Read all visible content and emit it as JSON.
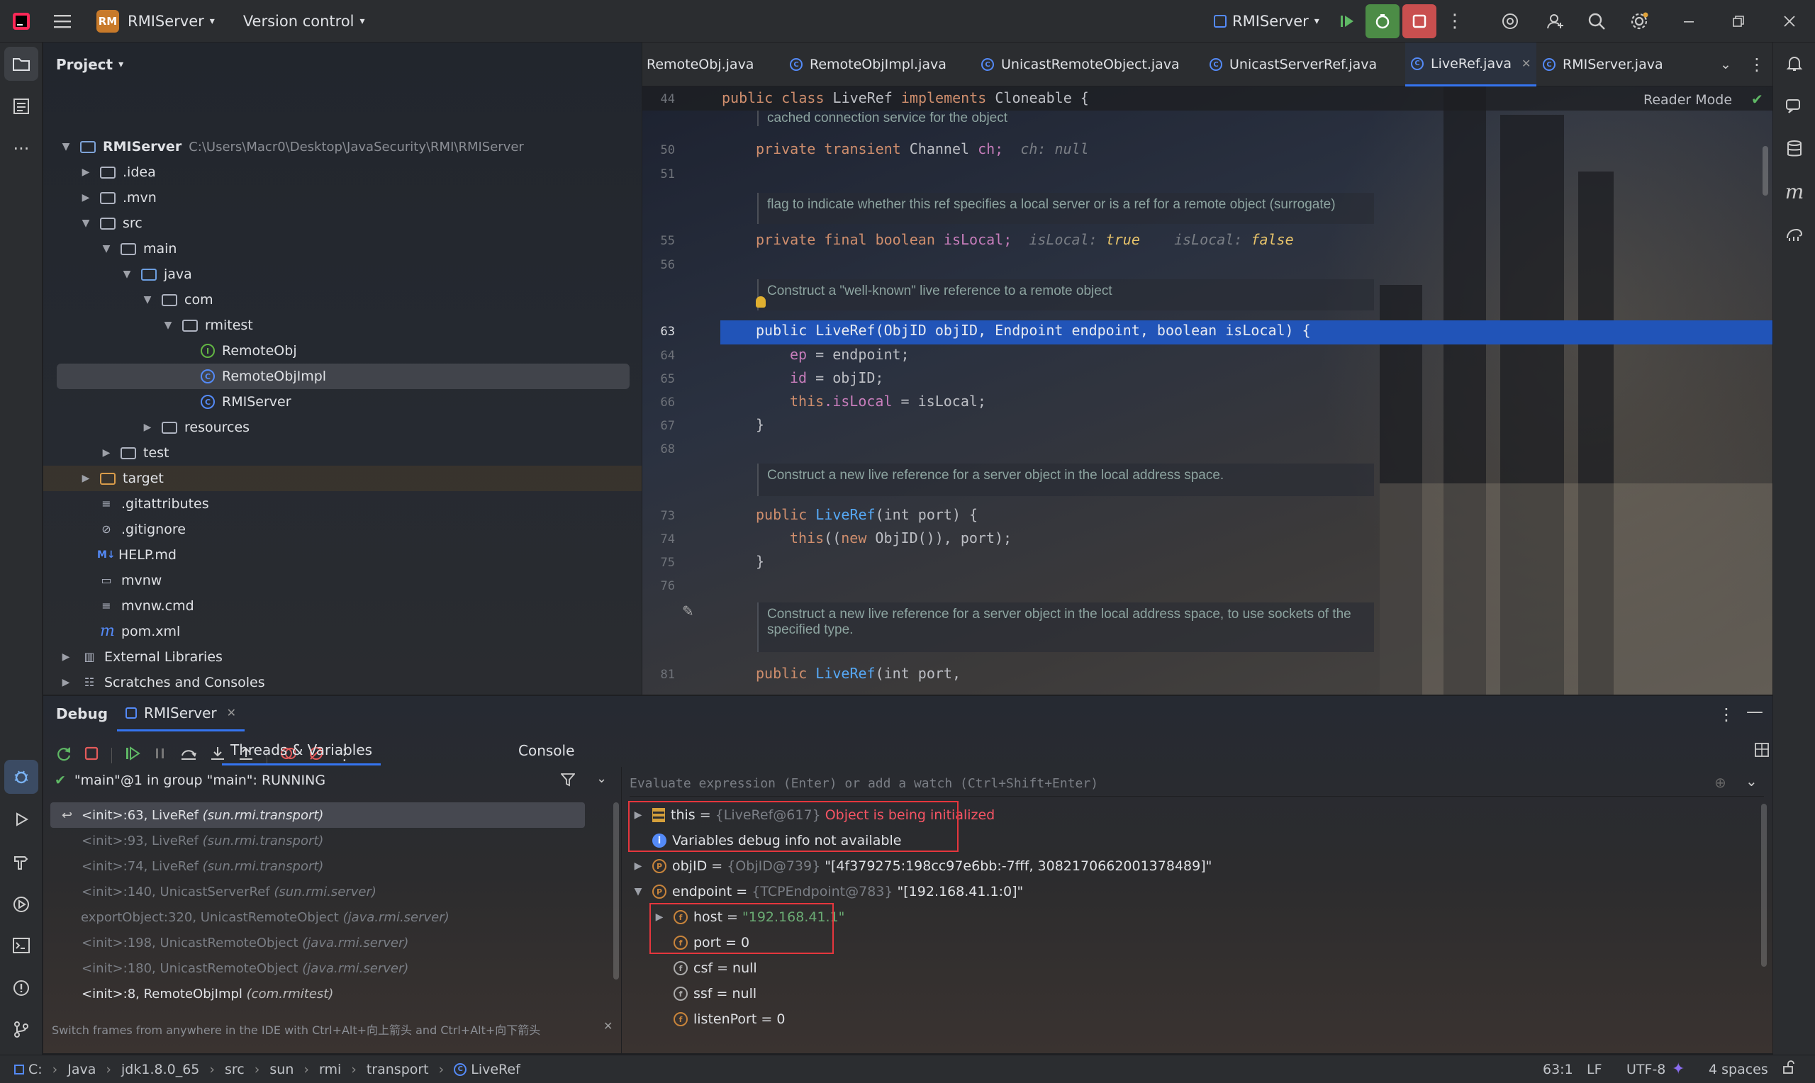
{
  "topbar": {
    "project_badge": "RM",
    "project_name": "RMIServer",
    "version_control": "Version control",
    "run_config": "RMIServer"
  },
  "project_panel": {
    "title": "Project",
    "tree": [
      {
        "label": "RMIServer",
        "path": "C:\\Users\\Macr0\\Desktop\\JavaSecurity\\RMI\\RMIServer"
      },
      {
        "label": ".idea"
      },
      {
        "label": ".mvn"
      },
      {
        "label": "src"
      },
      {
        "label": "main"
      },
      {
        "label": "java"
      },
      {
        "label": "com"
      },
      {
        "label": "rmitest"
      },
      {
        "label": "RemoteObj"
      },
      {
        "label": "RemoteObjImpl"
      },
      {
        "label": "RMIServer"
      },
      {
        "label": "resources"
      },
      {
        "label": "test"
      },
      {
        "label": "target"
      },
      {
        "label": ".gitattributes"
      },
      {
        "label": ".gitignore"
      },
      {
        "label": "HELP.md"
      },
      {
        "label": "mvnw"
      },
      {
        "label": "mvnw.cmd"
      },
      {
        "label": "pom.xml"
      },
      {
        "label": "External Libraries"
      },
      {
        "label": "Scratches and Consoles"
      }
    ],
    "badges": {
      "md": "M↓",
      "pom": "m"
    }
  },
  "tabs": [
    {
      "label": "RemoteObj.java"
    },
    {
      "label": "RemoteObjImpl.java"
    },
    {
      "label": "UnicastRemoteObject.java"
    },
    {
      "label": "UnicastServerRef.java"
    },
    {
      "label": "LiveRef.java"
    },
    {
      "label": "RMIServer.java"
    }
  ],
  "editor": {
    "reader_mode": "Reader Mode",
    "line_numbers": [
      "44",
      "50",
      "51",
      "55",
      "56",
      "63",
      "64",
      "65",
      "66",
      "67",
      "68",
      "73",
      "74",
      "75",
      "76",
      "81"
    ],
    "class_decl": {
      "kw": "public class",
      "name": "LiveRef",
      "impl": "implements",
      "iface": "Cloneable {"
    },
    "doc_cached": "cached connection service for the object",
    "line50": {
      "kw": "private transient",
      "type": "Channel",
      "field": "ch;",
      "hint": "ch: null"
    },
    "doc_flag": "flag to indicate whether this ref specifies a local server or is a ref for a remote object (surrogate)",
    "line55": {
      "kw": "private final boolean",
      "field": "isLocal;",
      "hint1": "isLocal:",
      "val1": "true",
      "hint2": "isLocal:",
      "val2": "false"
    },
    "doc_construct_known": "Construct a \"well-known\" live reference to a remote object",
    "line63": "public LiveRef(ObjID objID, Endpoint endpoint, boolean isLocal) {",
    "line64": {
      "field": "ep",
      "rest": " = endpoint;"
    },
    "line65": {
      "field": "id",
      "rest": " = objID;"
    },
    "line66": {
      "kw": "this",
      "field": ".isLocal",
      "rest": " = isLocal;"
    },
    "brace": "}",
    "doc_construct_local": "Construct a new live reference for a server object in the local address space.",
    "line73": {
      "kw": "public",
      "fn": "LiveRef",
      "rest": "(int port) {"
    },
    "line74": {
      "kw": "this",
      "rest1": "((",
      "kw2": "new",
      "rest2": " ObjID()), port);"
    },
    "doc_construct_sockets_1": "Construct a new live reference for a server object in the local address space, to use sockets of the",
    "doc_construct_sockets_2": "specified type.",
    "line81": {
      "kw": "public",
      "fn": "LiveRef",
      "rest": "(int port,"
    }
  },
  "debug": {
    "title": "Debug",
    "session": "RMIServer",
    "tab_threads": "Threads & Variables",
    "tab_console": "Console",
    "thread": "\"main\"@1 in group \"main\": RUNNING",
    "evaluate_placeholder": "Evaluate expression (Enter) or add a watch (Ctrl+Shift+Enter)",
    "frames": [
      {
        "method": "<init>:63, LiveRef",
        "cls": "(sun.rmi.transport)"
      },
      {
        "method": "<init>:93, LiveRef",
        "cls": "(sun.rmi.transport)"
      },
      {
        "method": "<init>:74, LiveRef",
        "cls": "(sun.rmi.transport)"
      },
      {
        "method": "<init>:140, UnicastServerRef",
        "cls": "(sun.rmi.server)"
      },
      {
        "method": "exportObject:320, UnicastRemoteObject",
        "cls": "(java.rmi.server)"
      },
      {
        "method": "<init>:198, UnicastRemoteObject",
        "cls": "(java.rmi.server)"
      },
      {
        "method": "<init>:180, UnicastRemoteObject",
        "cls": "(java.rmi.server)"
      },
      {
        "method": "<init>:8, RemoteObjImpl",
        "cls": "(com.rmitest)"
      }
    ],
    "hint": "Switch frames from anywhere in the IDE with Ctrl+Alt+向上箭头 and Ctrl+Alt+向下箭头",
    "vars": {
      "this_name": "this",
      "this_ref": "{LiveRef@617}",
      "this_msg": "Object is being initialized",
      "info": "Variables debug info not available",
      "objID_name": "objID",
      "objID_ref": "{ObjID@739}",
      "objID_val": "\"[4f379275:198cc97e6bb:-7fff, 3082170662001378489]\"",
      "endpoint_name": "endpoint",
      "endpoint_ref": "{TCPEndpoint@783}",
      "endpoint_val": "\"[192.168.41.1:0]\"",
      "host_name": "host",
      "host_val": "\"192.168.41.1\"",
      "port_name": "port",
      "port_val": "0",
      "csf_name": "csf",
      "csf_val": "null",
      "ssf_name": "ssf",
      "ssf_val": "null",
      "listenPort_name": "listenPort",
      "listenPort_val": "0",
      "eq": " = "
    }
  },
  "statusbar": {
    "crumbs": [
      "C:",
      "Java",
      "jdk1.8.0_65",
      "src",
      "sun",
      "rmi",
      "transport",
      "LiveRef"
    ],
    "position": "63:1",
    "line_sep": "LF",
    "encoding": "UTF-8",
    "indent": "4 spaces"
  }
}
